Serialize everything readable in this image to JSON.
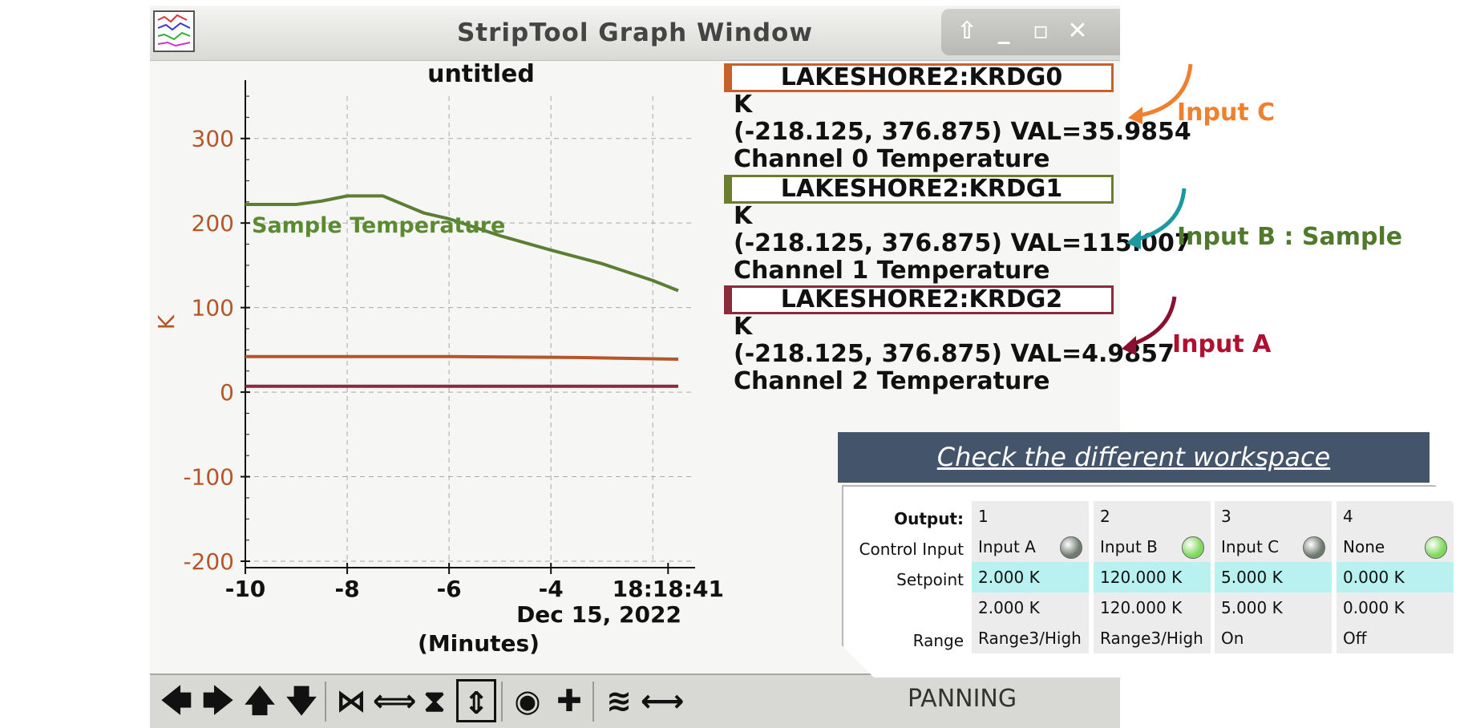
{
  "window": {
    "title": "StripTool Graph Window",
    "buttons": {
      "up": "⇧",
      "minimize": "_",
      "maximize": "▫",
      "close": "✕"
    }
  },
  "plot": {
    "title": "untitled",
    "ylabel": "K",
    "yticks": [
      "300",
      "200",
      "100",
      "0",
      "-100",
      "-200"
    ],
    "xticks": [
      "-10",
      "-8",
      "-6",
      "-4",
      "18:18:41"
    ],
    "date": "Dec 15, 2022",
    "xlabel": "(Minutes)",
    "annotation": "Sample Temperature"
  },
  "chart_data": {
    "type": "line",
    "title": "untitled",
    "xlabel": "(Minutes)",
    "ylabel": "K",
    "xlim": [
      -10,
      0
    ],
    "ylim": [
      -200,
      350
    ],
    "grid": true,
    "series": [
      {
        "name": "LAKESHORE2:KRDG0",
        "color": "#b5562a",
        "x": [
          -10,
          -6,
          -3.5,
          -1.5
        ],
        "y": [
          42,
          42,
          41,
          39
        ]
      },
      {
        "name": "LAKESHORE2:KRDG1",
        "color": "#5b7e34",
        "x": [
          -10,
          -9,
          -8.5,
          -8,
          -7.3,
          -6.5,
          -6,
          -5,
          -4,
          -3,
          -2,
          -1.5
        ],
        "y": [
          222,
          222,
          226,
          232,
          232,
          212,
          205,
          185,
          168,
          152,
          132,
          120
        ]
      },
      {
        "name": "LAKESHORE2:KRDG2",
        "color": "#8a2a3a",
        "x": [
          -10,
          -1.5
        ],
        "y": [
          7,
          7
        ]
      }
    ]
  },
  "legend": [
    {
      "name": "LAKESHORE2:KRDG0",
      "unit": "K",
      "range": "(-218.125, 376.875) VAL=35.9854",
      "desc": "Channel 0 Temperature",
      "color": "#c8602c"
    },
    {
      "name": "LAKESHORE2:KRDG1",
      "unit": "K",
      "range": "(-218.125, 376.875) VAL=115.007",
      "desc": "Channel 1 Temperature",
      "color": "#6b7d2f"
    },
    {
      "name": "LAKESHORE2:KRDG2",
      "unit": "K",
      "range": "(-218.125, 376.875) VAL=4.9857",
      "desc": "Channel 2 Temperature",
      "color": "#8a2a3a"
    }
  ],
  "annotations": [
    {
      "text": "Input C",
      "color": "#ee8030"
    },
    {
      "text": "Input B : Sample",
      "color": "#4f7a2c"
    },
    {
      "text": "Input A",
      "color": "#b01030"
    }
  ],
  "toolbar": {
    "status": "PANNING",
    "icons": [
      "arrow-left",
      "arrow-right",
      "arrow-up",
      "arrow-down",
      "zoom-in-x",
      "zoom-out-x",
      "zoom-in-y",
      "zoom-out-y",
      "auto-scale",
      "add",
      "fit",
      "pan"
    ]
  },
  "workspace": {
    "banner": "Check the different workspace",
    "labels": {
      "output": "Output:",
      "control": "Control Input",
      "setpoint": "Setpoint",
      "range": "Range"
    },
    "outputs": [
      {
        "num": "1",
        "input": "Input A",
        "led": "#6e7a6e",
        "setpoint": "2.000 K",
        "readback": "2.000 K",
        "range": "Range3/High"
      },
      {
        "num": "2",
        "input": "Input B",
        "led": "#7ed85a",
        "setpoint": "120.000 K",
        "readback": "120.000 K",
        "range": "Range3/High"
      },
      {
        "num": "3",
        "input": "Input C",
        "led": "#6e7a6e",
        "setpoint": "5.000 K",
        "readback": "5.000 K",
        "range": "On"
      },
      {
        "num": "4",
        "input": "None",
        "led": "#7ed85a",
        "setpoint": "0.000 K",
        "readback": "0.000 K",
        "range": "Off"
      }
    ]
  }
}
